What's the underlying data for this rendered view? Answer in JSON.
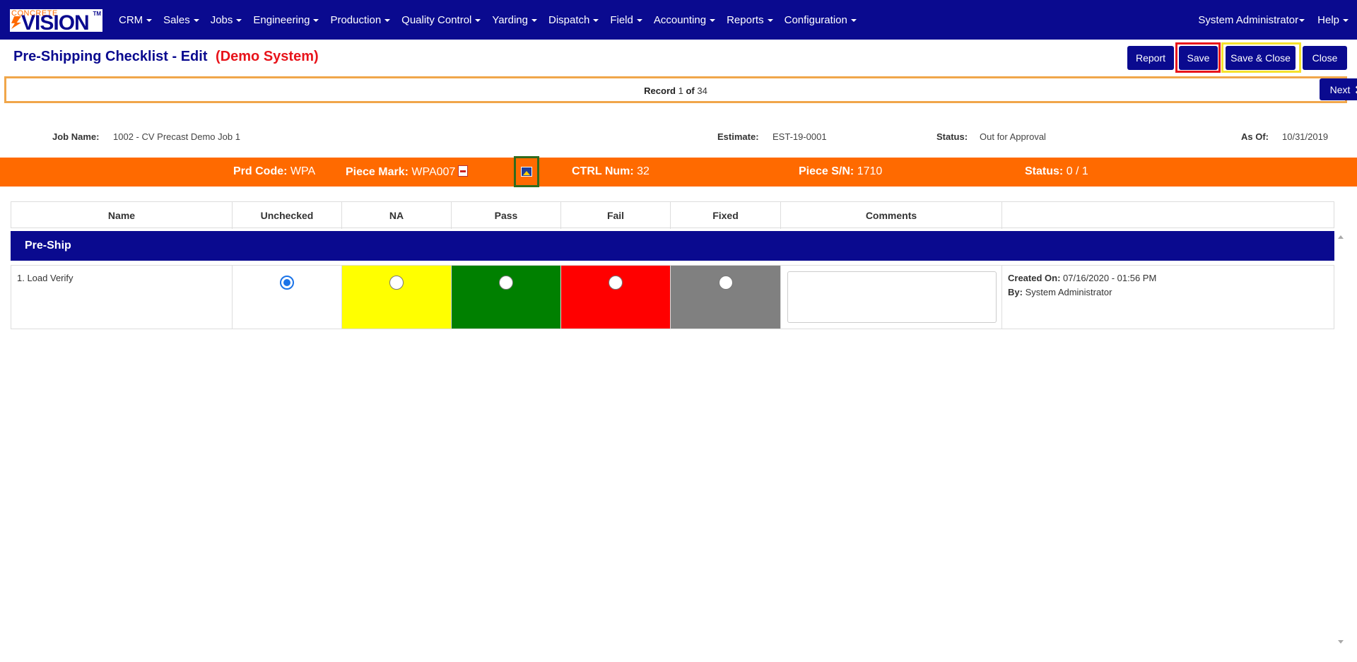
{
  "nav": {
    "logo_top": "CONCRETE",
    "logo_main": "VISION",
    "logo_tm": "TM",
    "items": [
      "CRM",
      "Sales",
      "Jobs",
      "Engineering",
      "Production",
      "Quality Control",
      "Yarding",
      "Dispatch",
      "Field",
      "Accounting",
      "Reports",
      "Configuration"
    ],
    "user": "System Administrator",
    "help": "Help"
  },
  "header": {
    "title": "Pre-Shipping Checklist - Edit",
    "demo_label": "(Demo System)",
    "buttons": {
      "report": "Report",
      "save": "Save",
      "save_close": "Save & Close",
      "close": "Close"
    }
  },
  "record": {
    "label": "Record",
    "current": "1",
    "of_label": "of",
    "total": "34",
    "next": "Next"
  },
  "info": {
    "job_name_label": "Job Name:",
    "job_name": "1002 - CV Precast Demo Job 1",
    "estimate_label": "Estimate:",
    "estimate": "EST-19-0001",
    "status_label": "Status:",
    "status": "Out for Approval",
    "as_of_label": "As Of:",
    "as_of": "10/31/2019"
  },
  "piece": {
    "prd_code_label": "Prd Code:",
    "prd_code": "WPA",
    "piece_mark_label": "Piece Mark:",
    "piece_mark": "WPA007",
    "ctrl_num_label": "CTRL Num:",
    "ctrl_num": "32",
    "piece_sn_label": "Piece S/N:",
    "piece_sn": "1710",
    "status_label": "Status:",
    "status": "0 / 1"
  },
  "table": {
    "columns": [
      "Name",
      "Unchecked",
      "NA",
      "Pass",
      "Fail",
      "Fixed",
      "Comments",
      ""
    ],
    "section": "Pre-Ship",
    "rows": [
      {
        "name": "1. Load Verify",
        "selected": "Unchecked",
        "comment": "",
        "created_on_label": "Created On:",
        "created_on": "07/16/2020 - 01:56 PM",
        "by_label": "By:",
        "by": "System Administrator"
      }
    ]
  },
  "colors": {
    "navy": "#0a0a8f",
    "orange": "#ff6a00",
    "na": "#ffff00",
    "pass": "#008000",
    "fail": "#ff0000",
    "fixed": "#808080",
    "demo_red": "#e8141b"
  }
}
